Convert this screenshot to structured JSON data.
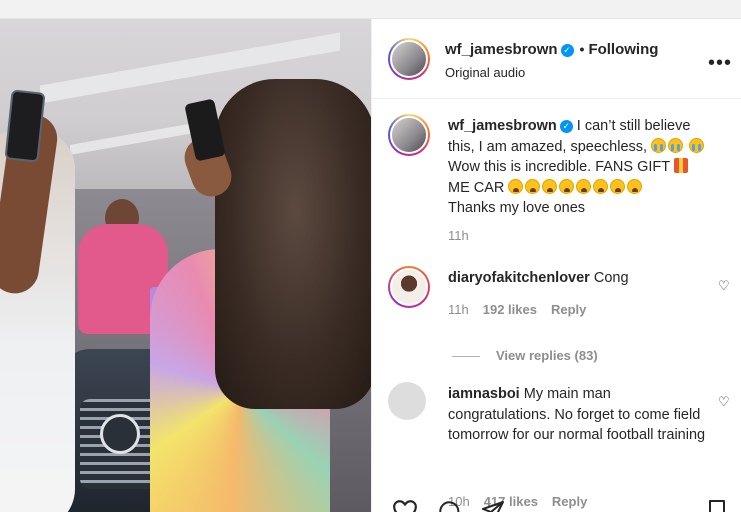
{
  "post": {
    "author": "wf_jamesbrown",
    "follow_status": "Following",
    "audio": "Original audio",
    "more_icon": "•••"
  },
  "caption": {
    "author": "wf_jamesbrown",
    "text_1": "I can’t still believe this, I am amazed, speechless,",
    "text_2": "Wow this is incredible. FANS GIFT",
    "text_3": "ME CAR",
    "text_4": "Thanks my love ones",
    "time": "11h"
  },
  "comments": [
    {
      "author": "diaryofakitchenlover",
      "text": "Cong",
      "time": "11h",
      "likes": "192 likes",
      "reply": "Reply",
      "view_replies": "View replies (83)"
    },
    {
      "author": "iamnasboi",
      "text": "My main man congratulations. No forget to come field tomorrow for our normal football training",
      "time": "10h",
      "likes": "417 likes",
      "reply": "Reply"
    }
  ],
  "icons": {
    "heart": "♡",
    "verified": "✓",
    "actions": [
      "heart-icon",
      "comment-icon",
      "share-icon",
      "save-icon"
    ]
  },
  "colors": {
    "verified": "#0095f6",
    "muted": "#8e8e8e",
    "text": "#262626"
  }
}
